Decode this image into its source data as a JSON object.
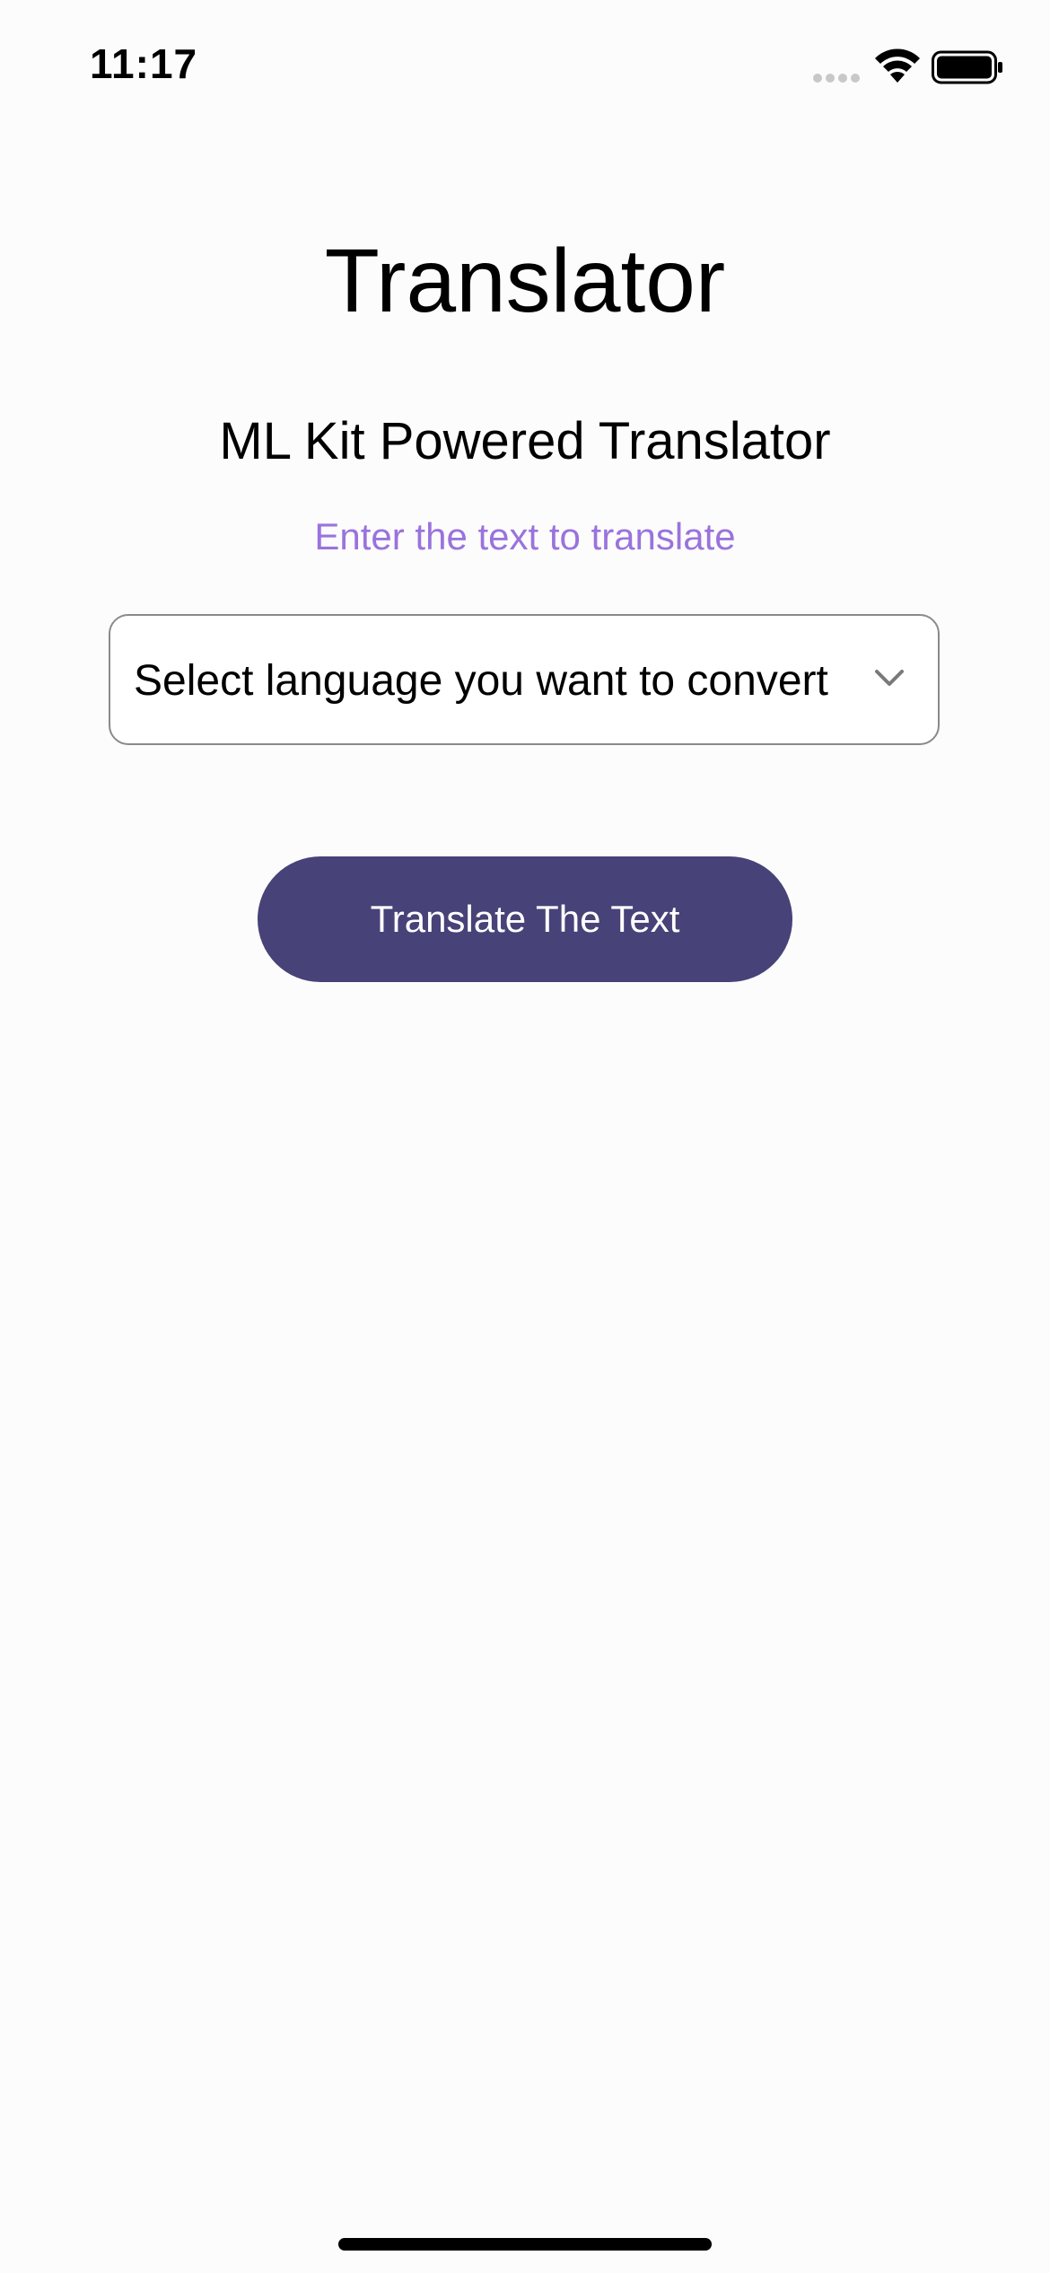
{
  "status_bar": {
    "time": "11:17",
    "icons": [
      "signal-icon",
      "wifi-icon",
      "battery-icon"
    ]
  },
  "header": {
    "title": "Translator"
  },
  "main": {
    "subtitle": "ML Kit Powered Translator",
    "hint": "Enter the text to translate",
    "language_select": {
      "selected_label": "Select language you want to convert",
      "icon": "chevron-down-icon"
    },
    "translate_button_label": "Translate The Text"
  },
  "colors": {
    "accent_hint": "#9a73dd",
    "button_background": "#474278",
    "background": "#fcfcfc"
  }
}
